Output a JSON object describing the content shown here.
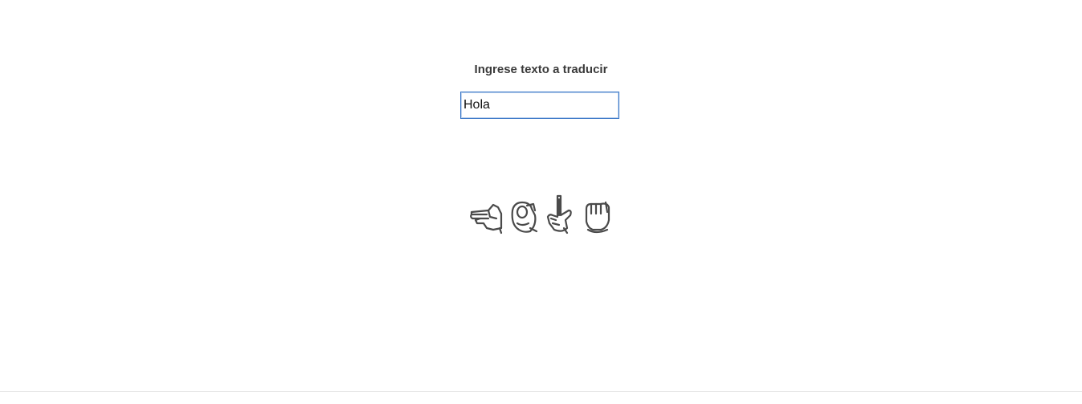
{
  "header": {
    "title": "Ingrese texto a traducir"
  },
  "translator": {
    "input_value": "Hola",
    "signs": [
      {
        "letter": "H",
        "icon": "hand-sign-h-icon"
      },
      {
        "letter": "O",
        "icon": "hand-sign-o-icon"
      },
      {
        "letter": "L",
        "icon": "hand-sign-l-icon"
      },
      {
        "letter": "A",
        "icon": "hand-sign-a-icon"
      }
    ]
  },
  "colors": {
    "input_border": "#3b78c8",
    "title_text": "#3a3a3a",
    "sign_ink": "#4a4a4a"
  }
}
